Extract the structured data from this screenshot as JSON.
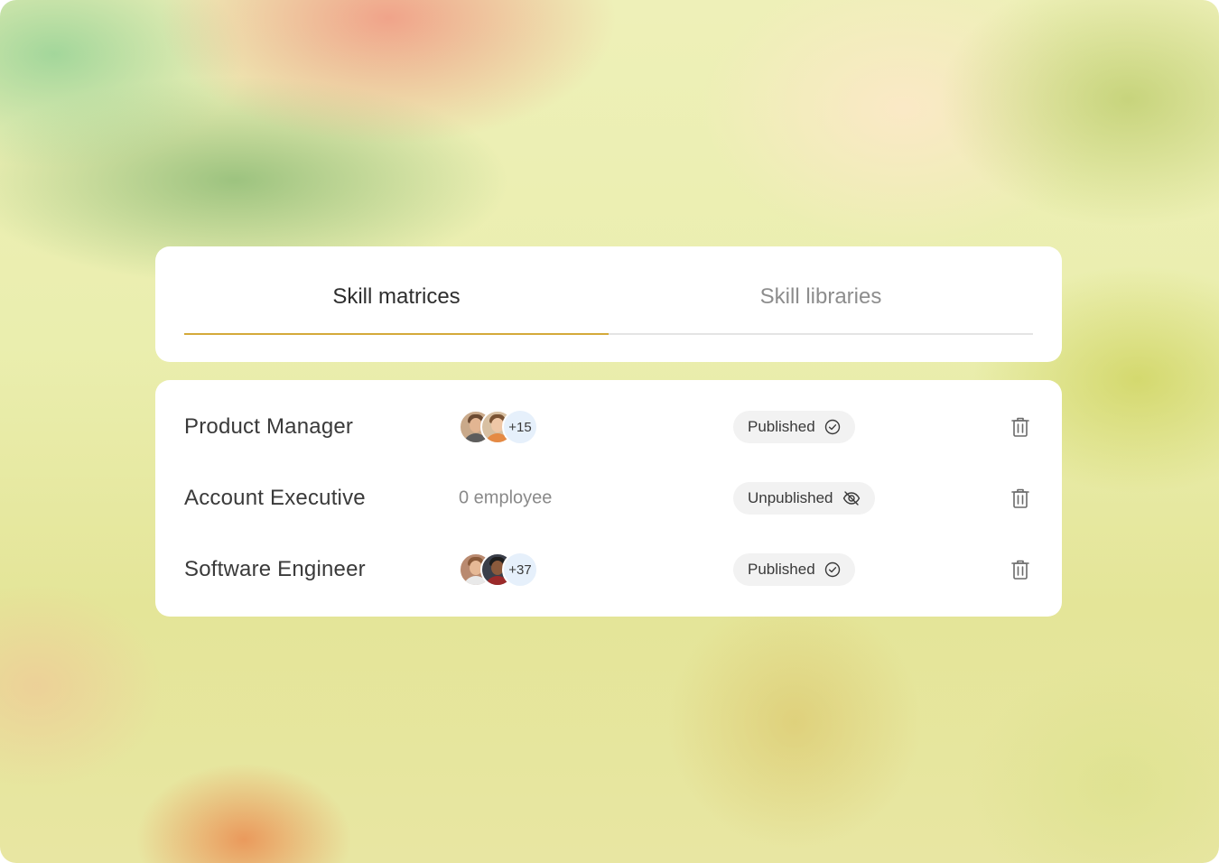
{
  "tabs": [
    {
      "label": "Skill matrices",
      "active": true
    },
    {
      "label": "Skill libraries",
      "active": false
    }
  ],
  "colors": {
    "tab_underline": "#d4a93a",
    "count_badge_bg": "#e6f0fb",
    "pill_bg": "#f2f2f2"
  },
  "rows": [
    {
      "title": "Product Manager",
      "extra_count": "+15",
      "status": "Published",
      "status_icon": "check-circle-icon"
    },
    {
      "title": "Account Executive",
      "employee_text": "0 employee",
      "status": "Unpublished",
      "status_icon": "eye-off-icon"
    },
    {
      "title": "Software Engineer",
      "extra_count": "+37",
      "status": "Published",
      "status_icon": "check-circle-icon"
    }
  ]
}
